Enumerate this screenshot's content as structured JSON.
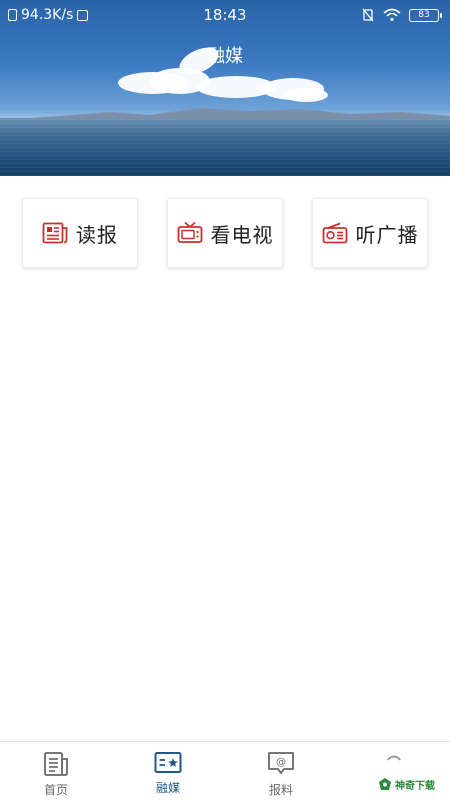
{
  "status_bar": {
    "speed": "94.3K/s",
    "time": "18:43",
    "battery": "83"
  },
  "header": {
    "title": "融媒"
  },
  "media_buttons": [
    {
      "label": "读报",
      "icon": "newspaper-icon"
    },
    {
      "label": "看电视",
      "icon": "tv-icon"
    },
    {
      "label": "听广播",
      "icon": "radio-icon"
    }
  ],
  "bottom_nav": [
    {
      "label": "首页",
      "icon": "home-icon",
      "active": false
    },
    {
      "label": "融媒",
      "icon": "media-icon",
      "active": true
    },
    {
      "label": "报料",
      "icon": "report-icon",
      "active": false
    },
    {
      "label": "",
      "icon": "loading-icon",
      "active": false
    }
  ],
  "watermark": {
    "text": "神奇下载"
  },
  "colors": {
    "accent": "#1f5a8a",
    "icon_red": "#c9302c",
    "inactive": "#666666"
  }
}
